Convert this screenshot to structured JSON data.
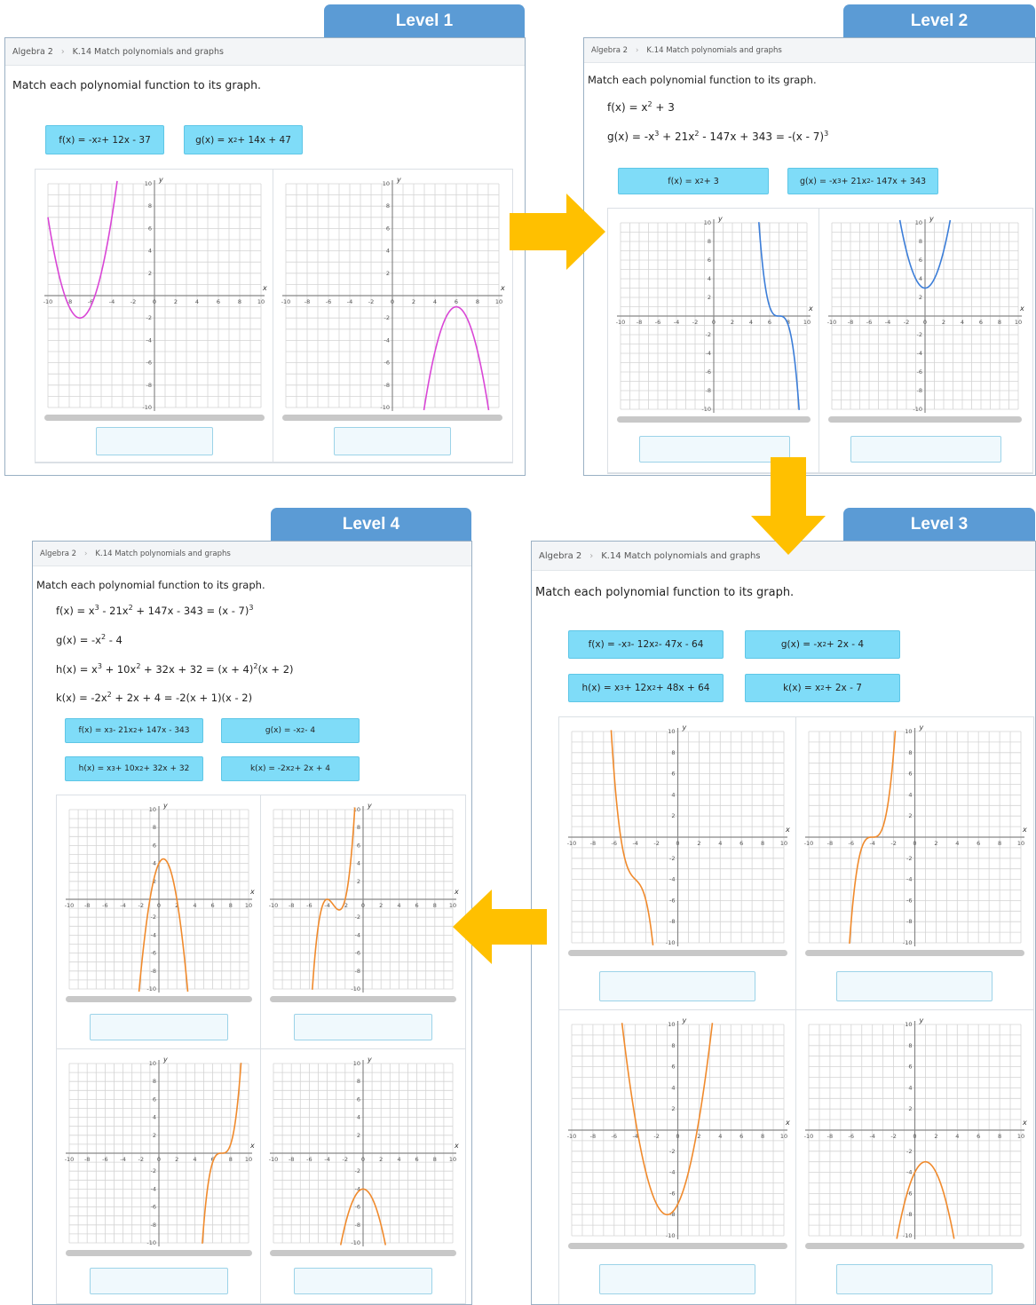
{
  "levels": [
    {
      "title": "Level 1",
      "breadcrumb": [
        "Algebra 2",
        "K.14 Match polynomials and graphs"
      ],
      "prompt": "Match each polynomial function to its graph.",
      "equations": [],
      "tiles": [
        {
          "name": "f",
          "label": "f(x) = -x² + 12x - 37"
        },
        {
          "name": "g",
          "label": "g(x) = x² + 14x + 47"
        }
      ],
      "curve_color": "#d946d6"
    },
    {
      "title": "Level 2",
      "breadcrumb": [
        "Algebra 2",
        "K.14 Match polynomials and graphs"
      ],
      "prompt": "Match each polynomial function to its graph.",
      "equations": [
        "f(x) = x² + 3",
        "g(x) = -x³ + 21x² - 147x + 343 = -(x - 7)³"
      ],
      "tiles": [
        {
          "name": "f",
          "label": "f(x) = x² + 3"
        },
        {
          "name": "g",
          "label": "g(x) = -x³ + 21x² - 147x + 343"
        }
      ],
      "curve_color": "#3b7dd8"
    },
    {
      "title": "Level 3",
      "breadcrumb": [
        "Algebra 2",
        "K.14 Match polynomials and graphs"
      ],
      "prompt": "Match each polynomial function to its graph.",
      "equations": [],
      "tiles": [
        {
          "name": "f",
          "label": "f(x) = -x³ - 12x² - 47x - 64"
        },
        {
          "name": "g",
          "label": "g(x) = -x² + 2x - 4"
        },
        {
          "name": "h",
          "label": "h(x) = x³ + 12x² + 48x + 64"
        },
        {
          "name": "k",
          "label": "k(x) = x² + 2x - 7"
        }
      ],
      "curve_color": "#f08a2c"
    },
    {
      "title": "Level 4",
      "breadcrumb": [
        "Algebra 2",
        "K.14 Match polynomials and graphs"
      ],
      "prompt": "Match each polynomial function to its graph.",
      "equations": [
        "f(x) = x³ - 21x² + 147x - 343 = (x - 7)³",
        "g(x) = -x² - 4",
        "h(x) = x³ + 10x² + 32x + 32 = (x + 4)²(x + 2)",
        "k(x) = -2x² + 2x + 4 = -2(x + 1)(x - 2)"
      ],
      "tiles": [
        {
          "name": "f",
          "label": "f(x) = x³ - 21x² + 147x - 343"
        },
        {
          "name": "g",
          "label": "g(x) = -x² - 4"
        },
        {
          "name": "h",
          "label": "h(x) = x³ + 10x² + 32x + 32"
        },
        {
          "name": "k",
          "label": "k(x) = -2x² + 2x + 4"
        }
      ],
      "curve_color": "#f08a2c"
    }
  ],
  "graph_axis": {
    "xlabel": "x",
    "ylabel": "y",
    "ticks": [
      "-10",
      "-8",
      "-6",
      "-4",
      "-2",
      "0",
      "2",
      "4",
      "6",
      "8",
      "10"
    ],
    "yticks": [
      "10",
      "8",
      "6",
      "4",
      "2",
      "-2",
      "-4",
      "-6",
      "-8",
      "-10"
    ]
  },
  "arrow_color": "#ffc000"
}
